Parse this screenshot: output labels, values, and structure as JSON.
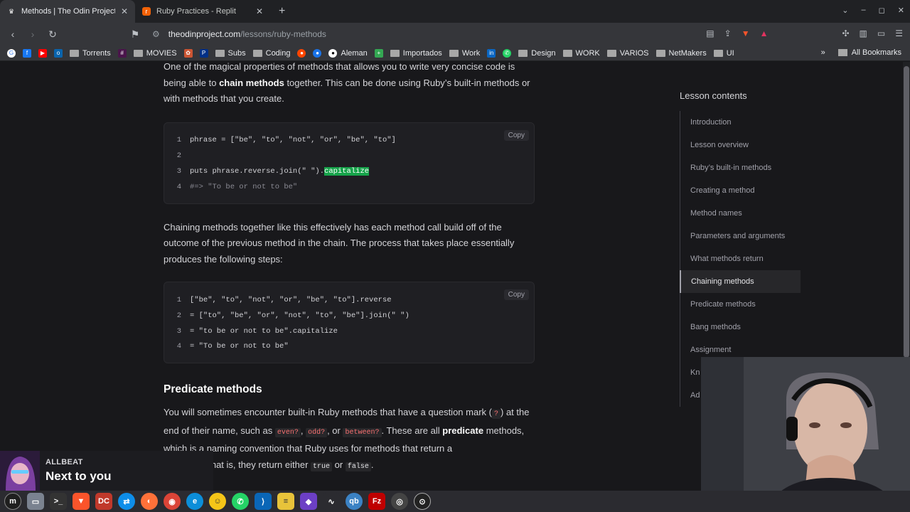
{
  "browser": {
    "tabs": [
      {
        "title": "Methods | The Odin Project",
        "active": true
      },
      {
        "title": "Ruby Practices - Replit",
        "active": false
      }
    ],
    "address": {
      "host": "theodinproject.com",
      "path": "/lessons/ruby-methods"
    },
    "bookmarks": [
      "Torrents",
      "MOVIES",
      "Subs",
      "Coding",
      "Aleman",
      "Importados",
      "Work",
      "Design",
      "WORK",
      "VARIOS",
      "NetMakers",
      "UI"
    ],
    "all_bookmarks": "All Bookmarks"
  },
  "article": {
    "intro": {
      "before": "One of the magical properties of methods that allows you to write very concise code is being able to ",
      "bold": "chain methods",
      "after": " together. This can be done using Ruby’s built-in methods or with methods that you create."
    },
    "code1": {
      "copy_label": "Copy",
      "lines": [
        {
          "n": "1",
          "code": "phrase = [\"be\", \"to\", \"not\", \"or\", \"be\", \"to\"]"
        },
        {
          "n": "2",
          "code": ""
        },
        {
          "n": "3",
          "pre": "puts phrase.reverse.join(\" \").",
          "hl": "capitalize"
        },
        {
          "n": "4",
          "comment": "#=> \"To be or not to be\""
        }
      ]
    },
    "chaining_para": "Chaining methods together like this effectively has each method call build off of the outcome of the previous method in the chain. The process that takes place essentially produces the following steps:",
    "code2": {
      "copy_label": "Copy",
      "lines": [
        {
          "n": "1",
          "code": "[\"be\", \"to\", \"not\", \"or\", \"be\", \"to\"].reverse"
        },
        {
          "n": "2",
          "code": "= [\"to\", \"be\", \"or\", \"not\", \"to\", \"be\"].join(\" \")"
        },
        {
          "n": "3",
          "code": "= \"to be or not to be\".capitalize"
        },
        {
          "n": "4",
          "code": "= \"To be or not to be\""
        }
      ]
    },
    "predicate_heading": "Predicate methods",
    "predicate_para": {
      "t1": "You will sometimes encounter built-in Ruby methods that have a question mark (",
      "qmark": "?",
      "t2": ") at the end of their name, such as ",
      "c1": "even?",
      "sep1": ", ",
      "c2": "odd?",
      "sep2": ", or ",
      "c3": "between?",
      "t3": ". These are all ",
      "bold": "predicate",
      "t4": " methods, which is a naming convention that Ruby uses for methods that return a ",
      "t5": ", that is, they return either ",
      "c4": "true",
      "t6": " or ",
      "c5": "false",
      "t7": "."
    }
  },
  "toc": {
    "title": "Lesson contents",
    "items": [
      "Introduction",
      "Lesson overview",
      "Ruby’s built-in methods",
      "Creating a method",
      "Method names",
      "Parameters and arguments",
      "What methods return",
      "Chaining methods",
      "Predicate methods",
      "Bang methods",
      "Assignment",
      "Kn",
      "Ad"
    ],
    "active_index": 7
  },
  "music": {
    "artist": "ALLBEAT",
    "song": "Next to you"
  },
  "colors": {
    "highlight": "#16a34a",
    "background": "#18181b",
    "inline_code": "#f87171"
  }
}
